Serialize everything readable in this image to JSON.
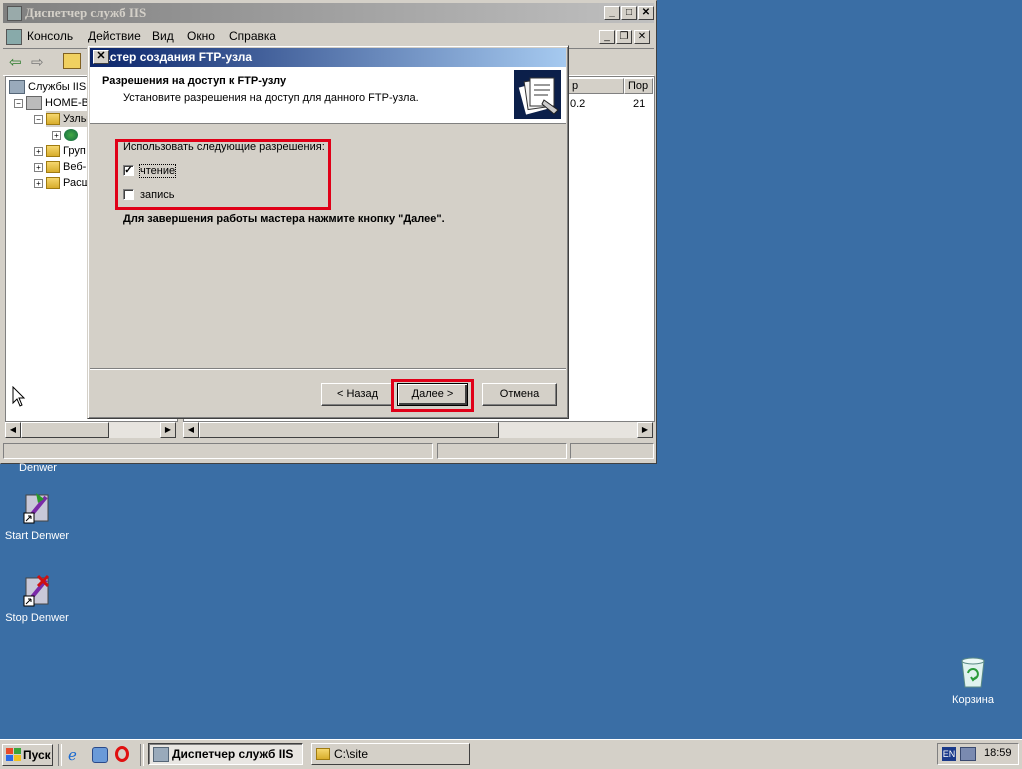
{
  "iis_window": {
    "title": "Диспетчер служб IIS",
    "caption_buttons": [
      "_",
      "□",
      "✕"
    ],
    "menu": [
      "Консоль",
      "Действие",
      "Вид",
      "Окно",
      "Справка"
    ],
    "menu_hotkeys": [
      "К",
      "Д",
      "В",
      "О",
      "С"
    ],
    "tree": {
      "items": [
        "Службы IIS",
        "HOME-B",
        "Узлы",
        "",
        "Груп",
        "Веб-",
        "Расш"
      ]
    },
    "list": {
      "headers": [
        "р",
        "Пор"
      ],
      "rows": [
        [
          "0.2",
          "21"
        ]
      ]
    }
  },
  "wizard": {
    "title": "Мастер создания FTP-узла",
    "close": "✕",
    "header_title": "Разрешения на доступ к FTP-узлу",
    "header_subtitle": "Установите разрешения на доступ для данного FTP-узла.",
    "group_label": "Использовать следующие разрешения:",
    "perm_read": {
      "label": "чтение",
      "checked": true
    },
    "perm_write": {
      "label": "запись",
      "checked": false
    },
    "finish_hint": "Для завершения работы мастера нажмите кнопку \"Далее\".",
    "btn_back": "< Назад",
    "btn_next": "Далее >",
    "btn_cancel": "Отмена"
  },
  "desktop": {
    "icons": [
      {
        "label": "Denwer",
        "icon": "denwer-icon"
      },
      {
        "label": "Start Denwer",
        "icon": "start-denwer-icon"
      },
      {
        "label": "Stop Denwer",
        "icon": "stop-denwer-icon"
      },
      {
        "label": "Корзина",
        "icon": "recycle-bin-icon"
      }
    ]
  },
  "taskbar": {
    "start_label": "Пуск",
    "tasks": [
      {
        "label": "Диспетчер служб IIS",
        "active": true
      },
      {
        "label": "C:\\site",
        "active": false
      }
    ],
    "tray": {
      "lang": "EN",
      "time": "18:59"
    }
  },
  "colors": {
    "desktop": "#3a6ea5",
    "highlight_red": "#e00018",
    "active_title": "#0a246a",
    "inactive_title": "#808080"
  }
}
